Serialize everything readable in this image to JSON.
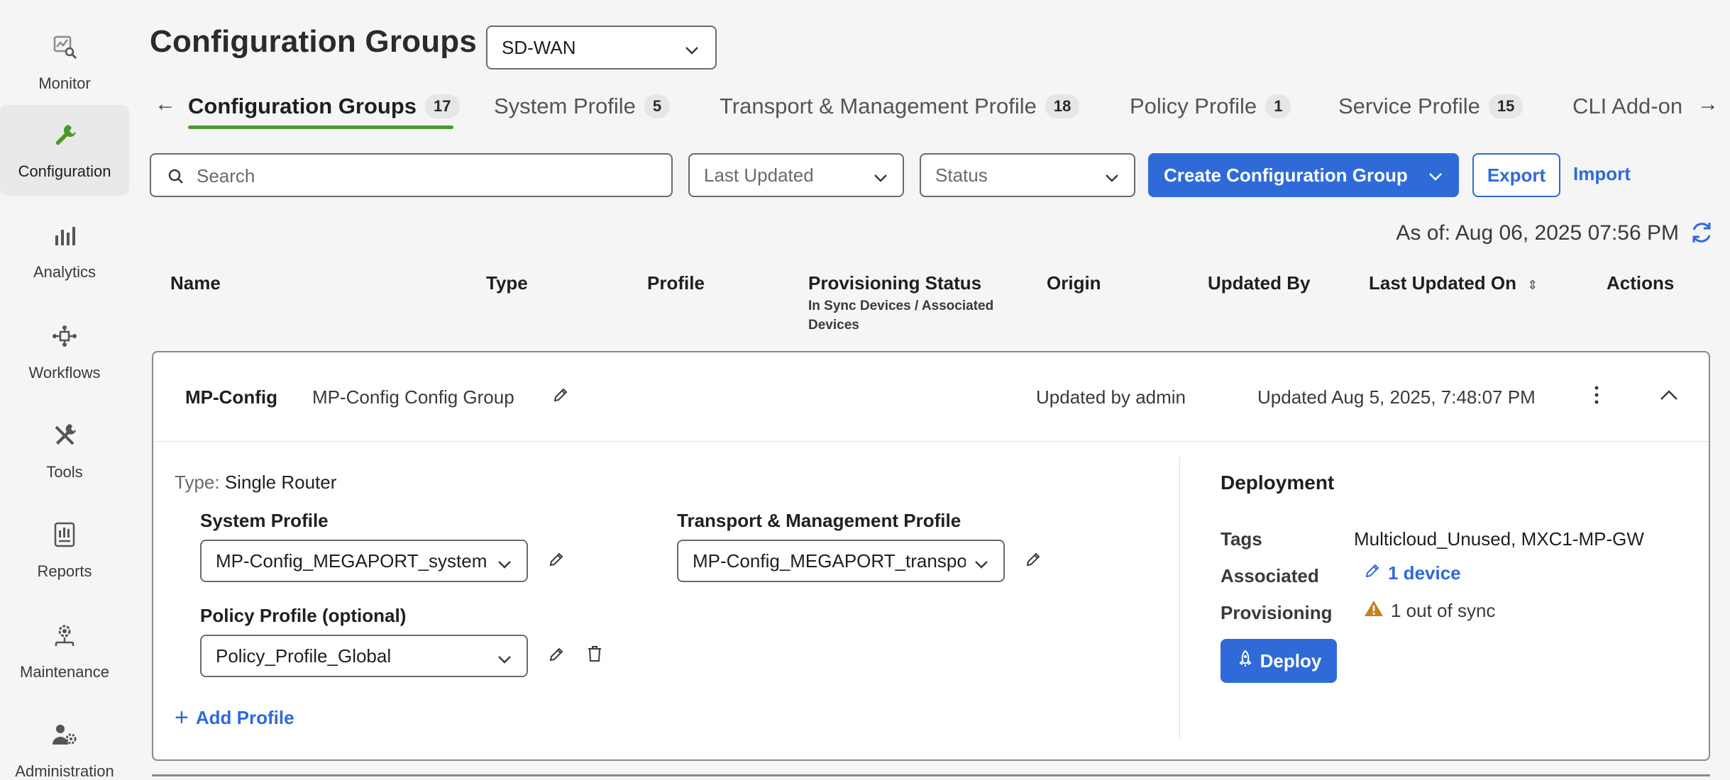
{
  "nav": {
    "items": [
      {
        "label": "Monitor",
        "icon": "monitor-icon"
      },
      {
        "label": "Configuration",
        "icon": "wrench-icon",
        "active": true
      },
      {
        "label": "Analytics",
        "icon": "bar-chart-icon"
      },
      {
        "label": "Workflows",
        "icon": "workflow-icon"
      },
      {
        "label": "Tools",
        "icon": "tools-icon"
      },
      {
        "label": "Reports",
        "icon": "report-icon"
      },
      {
        "label": "Maintenance",
        "icon": "maintenance-icon"
      },
      {
        "label": "Administration",
        "icon": "admin-icon"
      }
    ]
  },
  "header": {
    "title": "Configuration Groups",
    "domain_select": "SD-WAN"
  },
  "tabs": [
    {
      "label": "Configuration Groups",
      "count": "17"
    },
    {
      "label": "System Profile",
      "count": "5"
    },
    {
      "label": "Transport & Management Profile",
      "count": "18"
    },
    {
      "label": "Policy Profile",
      "count": "1"
    },
    {
      "label": "Service Profile",
      "count": "15"
    },
    {
      "label": "CLI Add-on"
    }
  ],
  "toolbar": {
    "search_placeholder": "Search",
    "sort_dropdown": "Last Updated",
    "status_dropdown": "Status",
    "create_label": "Create Configuration Group",
    "export_label": "Export",
    "import_label": "Import"
  },
  "as_of": "As of: Aug 06, 2025 07:56 PM",
  "table": {
    "columns": {
      "name": "Name",
      "type": "Type",
      "profile": "Profile",
      "provisioning": "Provisioning Status",
      "provisioning_sub": "In Sync Devices / Associated Devices",
      "origin": "Origin",
      "updated_by": "Updated By",
      "last_updated": "Last Updated On",
      "actions": "Actions"
    }
  },
  "group": {
    "name": "MP-Config",
    "description": "MP-Config Config Group",
    "updated_by": "Updated by admin",
    "updated_on": "Updated Aug 5, 2025, 7:48:07 PM",
    "type_key": "Type:",
    "type_value": "Single Router",
    "system_profile_label": "System Profile",
    "system_profile_value": "MP-Config_MEGAPORT_system",
    "transport_profile_label": "Transport & Management Profile",
    "transport_profile_value": "MP-Config_MEGAPORT_transpo",
    "policy_profile_label": "Policy Profile (optional)",
    "policy_profile_value": "Policy_Profile_Global",
    "add_profile": "Add Profile",
    "deployment": {
      "title": "Deployment",
      "tags_key": "Tags",
      "tags_value": "Multicloud_Unused, MXC1-MP-GW",
      "associated_key": "Associated",
      "associated_value": "1 device",
      "provisioning_key": "Provisioning",
      "provisioning_value": "1 out of sync",
      "deploy_label": "Deploy"
    }
  },
  "colors": {
    "accent": "#2f6ad8",
    "active_tab": "#4a9a2b",
    "nav_active_icon": "#4a9a2b",
    "warning": "#c7821e"
  }
}
